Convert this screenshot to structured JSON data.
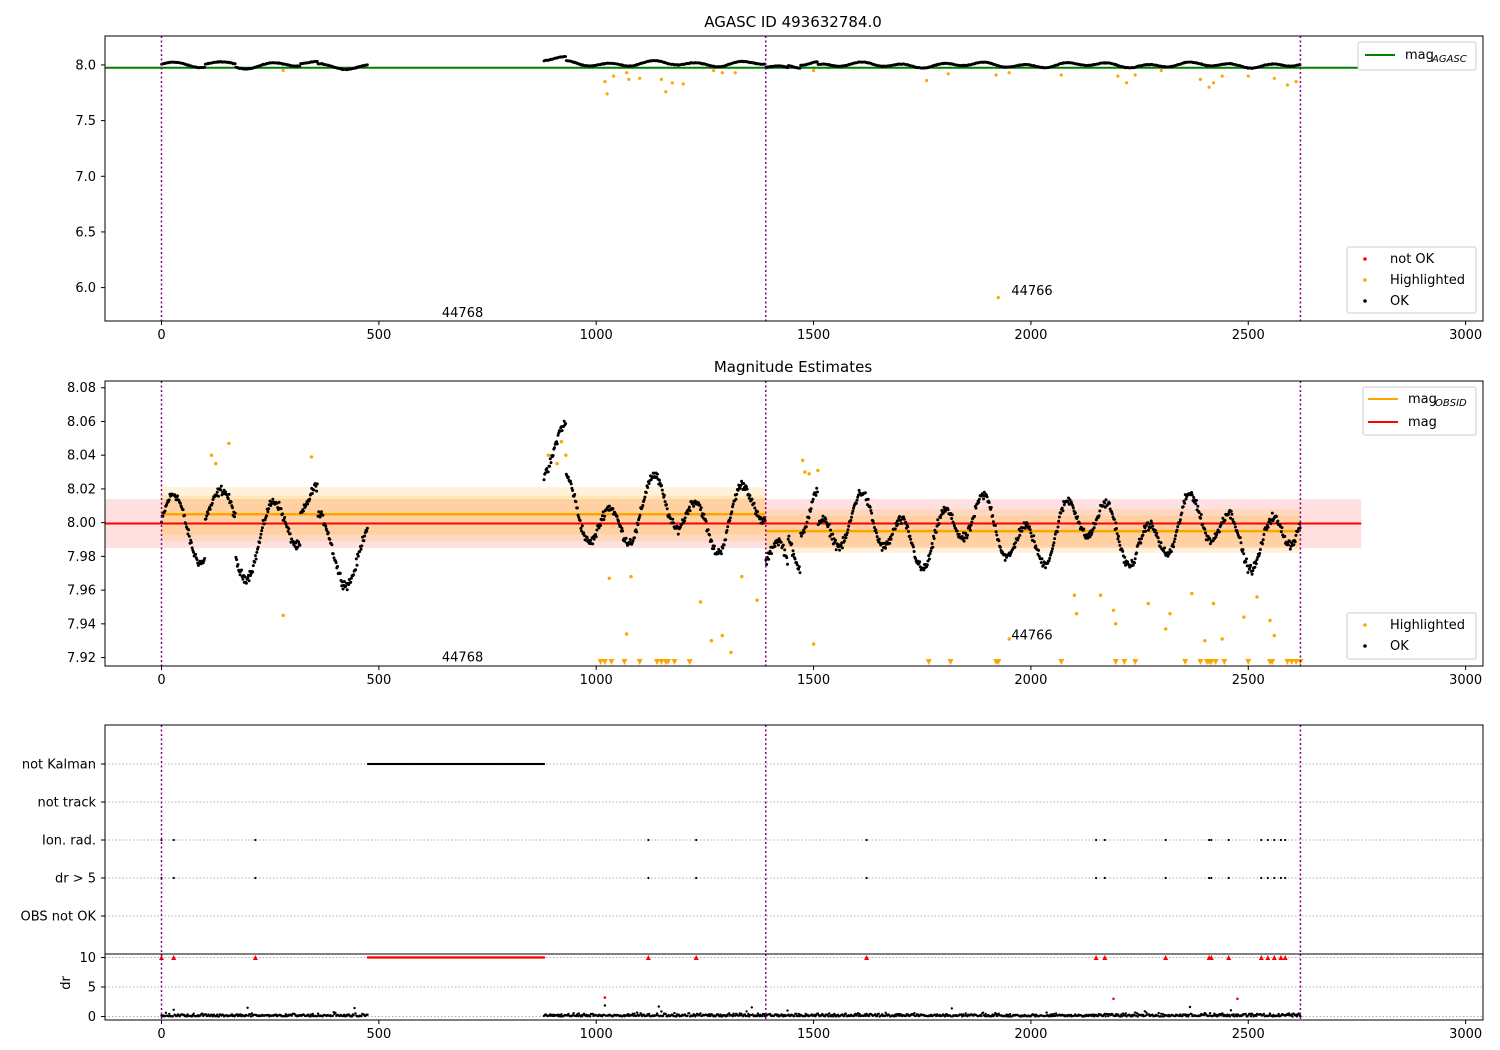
{
  "figure": {
    "panel1": {
      "title": "AGASC ID 493632784.0",
      "x_ticks": [
        0,
        500,
        1000,
        1500,
        2000,
        2500,
        3000
      ],
      "xlim": [
        -130,
        3040
      ],
      "y_ticks": [
        6.0,
        6.5,
        7.0,
        7.5,
        8.0
      ],
      "y_tick_labels": [
        "6.0",
        "6.5",
        "7.0",
        "7.5",
        "8.0"
      ],
      "ylim": [
        5.7,
        8.26
      ],
      "legend_top": {
        "line_label": "mag",
        "line_subscript": "AGASC"
      },
      "legend_bottom": [
        "not OK",
        "Highlighted",
        "OK"
      ],
      "annotations": [
        {
          "text": "44768",
          "x": 645,
          "y": 5.77
        },
        {
          "text": "44766",
          "x": 1955,
          "y": 5.97
        }
      ],
      "agasc_mag": 7.975,
      "agasc_line_x": [
        -130,
        2760
      ]
    },
    "panel2": {
      "title": "Magnitude Estimates",
      "x_ticks": [
        0,
        500,
        1000,
        1500,
        2000,
        2500,
        3000
      ],
      "xlim": [
        -130,
        3040
      ],
      "y_ticks": [
        7.92,
        7.94,
        7.96,
        7.98,
        8.0,
        8.02,
        8.04,
        8.06,
        8.08
      ],
      "y_tick_labels": [
        "7.92",
        "7.94",
        "7.96",
        "7.98",
        "8.00",
        "8.02",
        "8.04",
        "8.06",
        "8.08"
      ],
      "ylim": [
        7.915,
        8.084
      ],
      "legend_top": {
        "line1_label": "mag",
        "line1_subscript": "OBSID",
        "line2_label": "mag"
      },
      "legend_bottom": [
        "Highlighted",
        "OK"
      ],
      "annotations": [
        {
          "text": "44768",
          "x": 645,
          "y": 7.92
        },
        {
          "text": "44766",
          "x": 1955,
          "y": 7.933
        }
      ],
      "mag": 7.9995,
      "mag_band": [
        7.985,
        8.014
      ],
      "mag_x": [
        -130,
        2760
      ],
      "obsid_segments": [
        {
          "x0": 0,
          "x1": 1390,
          "mag": 8.005,
          "band": [
            7.989,
            8.021
          ],
          "band_inner": [
            7.993,
            8.016
          ]
        },
        {
          "x0": 1390,
          "x1": 2620,
          "mag": 7.995,
          "band": [
            7.982,
            8.008
          ],
          "band_inner": [
            7.986,
            8.004
          ]
        }
      ]
    },
    "panel3": {
      "flag_labels": [
        "not Kalman",
        "not track",
        "Ion. rad.",
        "dr > 5",
        "OBS not OK"
      ],
      "x_ticks": [
        0,
        500,
        1000,
        1500,
        2000,
        2500,
        3000
      ],
      "xlim": [
        -130,
        3040
      ],
      "not_kalman_range": [
        475,
        880
      ],
      "ion_rad_x": [
        0,
        28,
        216,
        1120,
        1230,
        1622,
        2150,
        2170,
        2310,
        2410,
        2415,
        2455,
        2530,
        2545,
        2560,
        2575,
        2585
      ],
      "dr5_x": [
        0,
        28,
        216,
        1120,
        1230,
        1622,
        2150,
        2170,
        2310,
        2410,
        2415,
        2455,
        2530,
        2545,
        2560,
        2575,
        2585
      ]
    },
    "panel4": {
      "ylabel": "dr",
      "y_ticks": [
        0,
        5,
        10
      ],
      "y_tick_labels": [
        "0",
        "5",
        "10"
      ],
      "ylim": [
        -0.6,
        10.6
      ],
      "x_ticks": [
        0,
        500,
        1000,
        1500,
        2000,
        2500,
        3000
      ],
      "x_tick_labels": [
        "0",
        "500",
        "1000",
        "1500",
        "2000",
        "2500",
        "3000"
      ],
      "xlim": [
        -130,
        3040
      ]
    },
    "obsid_boundaries": [
      0,
      1390,
      2620
    ],
    "colors": {
      "ok": "#000000",
      "highlighted": "#ffa500",
      "not_ok": "#ff0000",
      "agasc_line": "#008000",
      "mag_line": "#ff0000",
      "obsid_line": "#ffa500",
      "boundary": "#800080"
    }
  },
  "chart_data": [
    {
      "type": "scatter",
      "title": "AGASC ID 493632784.0",
      "xlabel": "",
      "ylabel": "",
      "xlim": [
        -130,
        3040
      ],
      "ylim": [
        5.7,
        8.26
      ],
      "series": [
        {
          "name": "OK",
          "description_segments": [
            [
              0,
              475,
              7.99,
              8.04
            ],
            [
              880,
              1390,
              7.98,
              8.04
            ],
            [
              1390,
              2620,
              7.97,
              8.04
            ]
          ]
        },
        {
          "name": "Highlighted",
          "points": [
            [
              280,
              7.95
            ],
            [
              1020,
              7.85
            ],
            [
              1025,
              7.74
            ],
            [
              1040,
              7.9
            ],
            [
              1070,
              7.93
            ],
            [
              1075,
              7.87
            ],
            [
              1100,
              7.88
            ],
            [
              1150,
              7.87
            ],
            [
              1160,
              7.76
            ],
            [
              1175,
              7.84
            ],
            [
              1200,
              7.83
            ],
            [
              1270,
              7.95
            ],
            [
              1290,
              7.93
            ],
            [
              1320,
              7.93
            ],
            [
              1500,
              7.95
            ],
            [
              1760,
              7.86
            ],
            [
              1810,
              7.92
            ],
            [
              1920,
              7.91
            ],
            [
              1925,
              5.91
            ],
            [
              1950,
              7.93
            ],
            [
              2070,
              7.91
            ],
            [
              2200,
              7.9
            ],
            [
              2220,
              7.84
            ],
            [
              2240,
              7.91
            ],
            [
              2300,
              7.95
            ],
            [
              2390,
              7.87
            ],
            [
              2410,
              7.8
            ],
            [
              2420,
              7.84
            ],
            [
              2440,
              7.9
            ],
            [
              2500,
              7.9
            ],
            [
              2560,
              7.88
            ],
            [
              2590,
              7.82
            ],
            [
              2610,
              7.85
            ]
          ]
        },
        {
          "name": "not OK",
          "points": []
        },
        {
          "name": "mag_AGASC",
          "y": 7.975
        }
      ],
      "annotations": [
        {
          "text": "44768"
        },
        {
          "text": "44766"
        }
      ]
    },
    {
      "type": "scatter",
      "title": "Magnitude Estimates",
      "xlim": [
        -130,
        3040
      ],
      "ylim": [
        7.915,
        8.084
      ],
      "series": [
        {
          "name": "mag_OBSID",
          "segments": [
            {
              "x": [
                0,
                1390
              ],
              "y": 8.005
            },
            {
              "x": [
                1390,
                2620
              ],
              "y": 7.995
            }
          ]
        },
        {
          "name": "mag",
          "y": 7.9995
        },
        {
          "name": "Highlighted",
          "points": [
            [
              115,
              8.04
            ],
            [
              125,
              8.035
            ],
            [
              155,
              8.047
            ],
            [
              280,
              7.945
            ],
            [
              345,
              8.039
            ],
            [
              890,
              8.04
            ],
            [
              910,
              8.035
            ],
            [
              920,
              8.048
            ],
            [
              930,
              8.04
            ],
            [
              1030,
              7.967
            ],
            [
              1070,
              7.934
            ],
            [
              1080,
              7.968
            ],
            [
              1240,
              7.953
            ],
            [
              1265,
              7.93
            ],
            [
              1290,
              7.933
            ],
            [
              1310,
              7.923
            ],
            [
              1335,
              7.968
            ],
            [
              1370,
              7.954
            ],
            [
              1475,
              8.037
            ],
            [
              1480,
              8.03
            ],
            [
              1490,
              8.029
            ],
            [
              1500,
              7.928
            ],
            [
              1510,
              8.031
            ],
            [
              1950,
              7.931
            ],
            [
              2100,
              7.957
            ],
            [
              2105,
              7.946
            ],
            [
              2160,
              7.957
            ],
            [
              2190,
              7.948
            ],
            [
              2195,
              7.94
            ],
            [
              2270,
              7.952
            ],
            [
              2310,
              7.937
            ],
            [
              2320,
              7.946
            ],
            [
              2370,
              7.958
            ],
            [
              2400,
              7.93
            ],
            [
              2420,
              7.952
            ],
            [
              2440,
              7.931
            ],
            [
              2490,
              7.944
            ],
            [
              2520,
              7.956
            ],
            [
              2550,
              7.942
            ],
            [
              2560,
              7.933
            ]
          ]
        }
      ],
      "annotations": [
        {
          "text": "44768"
        },
        {
          "text": "44766"
        }
      ]
    },
    {
      "type": "scatter",
      "title": "",
      "ylabel": "dr",
      "xlim": [
        -130,
        3040
      ],
      "ylim": [
        -0.6,
        10.6
      ],
      "series": [
        {
          "name": "OK",
          "description_segments": [
            [
              0,
              475,
              0,
              1
            ],
            [
              880,
              2620,
              0,
              1.5
            ]
          ]
        },
        {
          "name": "not OK",
          "points": [
            [
              0,
              10
            ],
            [
              28,
              10
            ],
            [
              216,
              10
            ],
            [
              1020,
              3.2
            ],
            [
              1120,
              10
            ],
            [
              1230,
              10
            ],
            [
              1622,
              10
            ],
            [
              2150,
              10
            ],
            [
              2170,
              10
            ],
            [
              2190,
              3.0
            ],
            [
              2310,
              10
            ],
            [
              2410,
              10
            ],
            [
              2415,
              10
            ],
            [
              2455,
              10
            ],
            [
              2475,
              3.0
            ],
            [
              2530,
              10
            ],
            [
              2545,
              10
            ],
            [
              2560,
              10
            ],
            [
              2575,
              10
            ],
            [
              2585,
              10
            ]
          ]
        },
        {
          "name": "not OK (not Kalman)",
          "x_range": [
            475,
            880
          ],
          "y": 10
        }
      ]
    }
  ]
}
